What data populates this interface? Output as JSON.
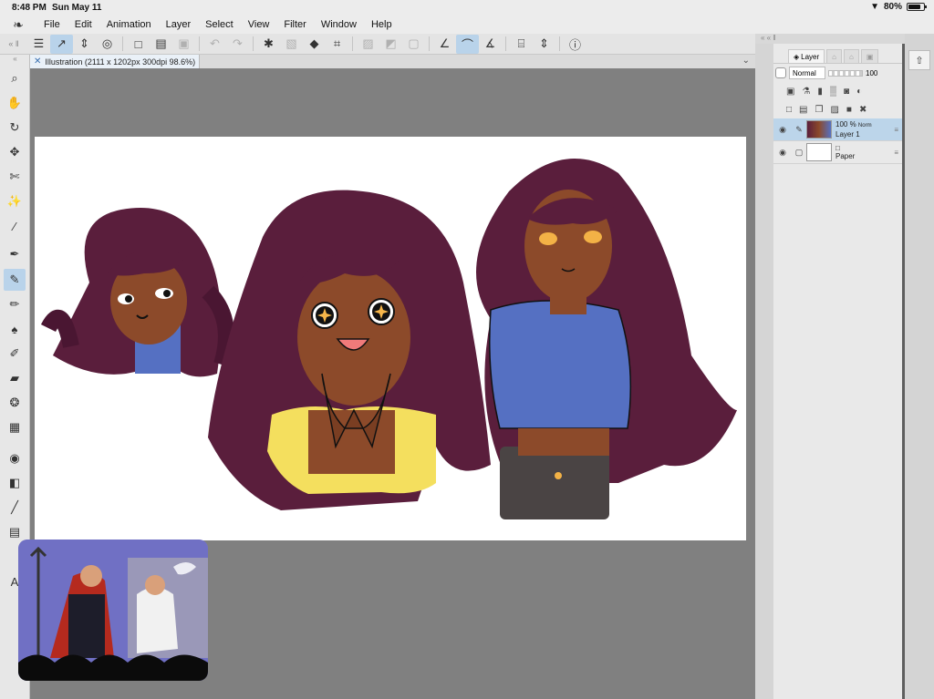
{
  "status": {
    "time": "8:48 PM",
    "date": "Sun May 11",
    "battery": "80%",
    "battery_fraction": 0.8
  },
  "menu": [
    "File",
    "Edit",
    "Animation",
    "Layer",
    "Select",
    "View",
    "Filter",
    "Window",
    "Help"
  ],
  "toolbar": {
    "icons": [
      "menu-icon",
      "cursor-icon",
      "quick-access-icon",
      "settings-icon",
      "new-icon",
      "open-icon",
      "save-icon",
      "undo-icon",
      "redo-icon",
      "loading-icon",
      "transform-icon",
      "fill-icon",
      "crop-icon",
      "clear-icon",
      "invert-icon",
      "select-icon",
      "brush-icon",
      "pen-icon",
      "pencil-icon",
      "align-icon",
      "chevrons-icon",
      "help-icon"
    ]
  },
  "document": {
    "tab_label": "Illustration (2111 x 1202px 300dpi 98.6%)"
  },
  "tools": [
    "zoom",
    "hand",
    "rotate",
    "move",
    "select",
    "wand",
    "eyedropper",
    "pen",
    "brush",
    "marker",
    "airbrush",
    "dropper",
    "eraser",
    "blend",
    "frame",
    "fill",
    "gradient",
    "line",
    "panel",
    "text"
  ],
  "layers_panel": {
    "tab_label": "Layer",
    "blend_mode": "Normal",
    "opacity": "100",
    "layers": [
      {
        "opacity": "100 %",
        "mode": "Norm",
        "name": "Layer 1",
        "selected": true
      },
      {
        "name": "Paper",
        "selected": false
      }
    ]
  }
}
